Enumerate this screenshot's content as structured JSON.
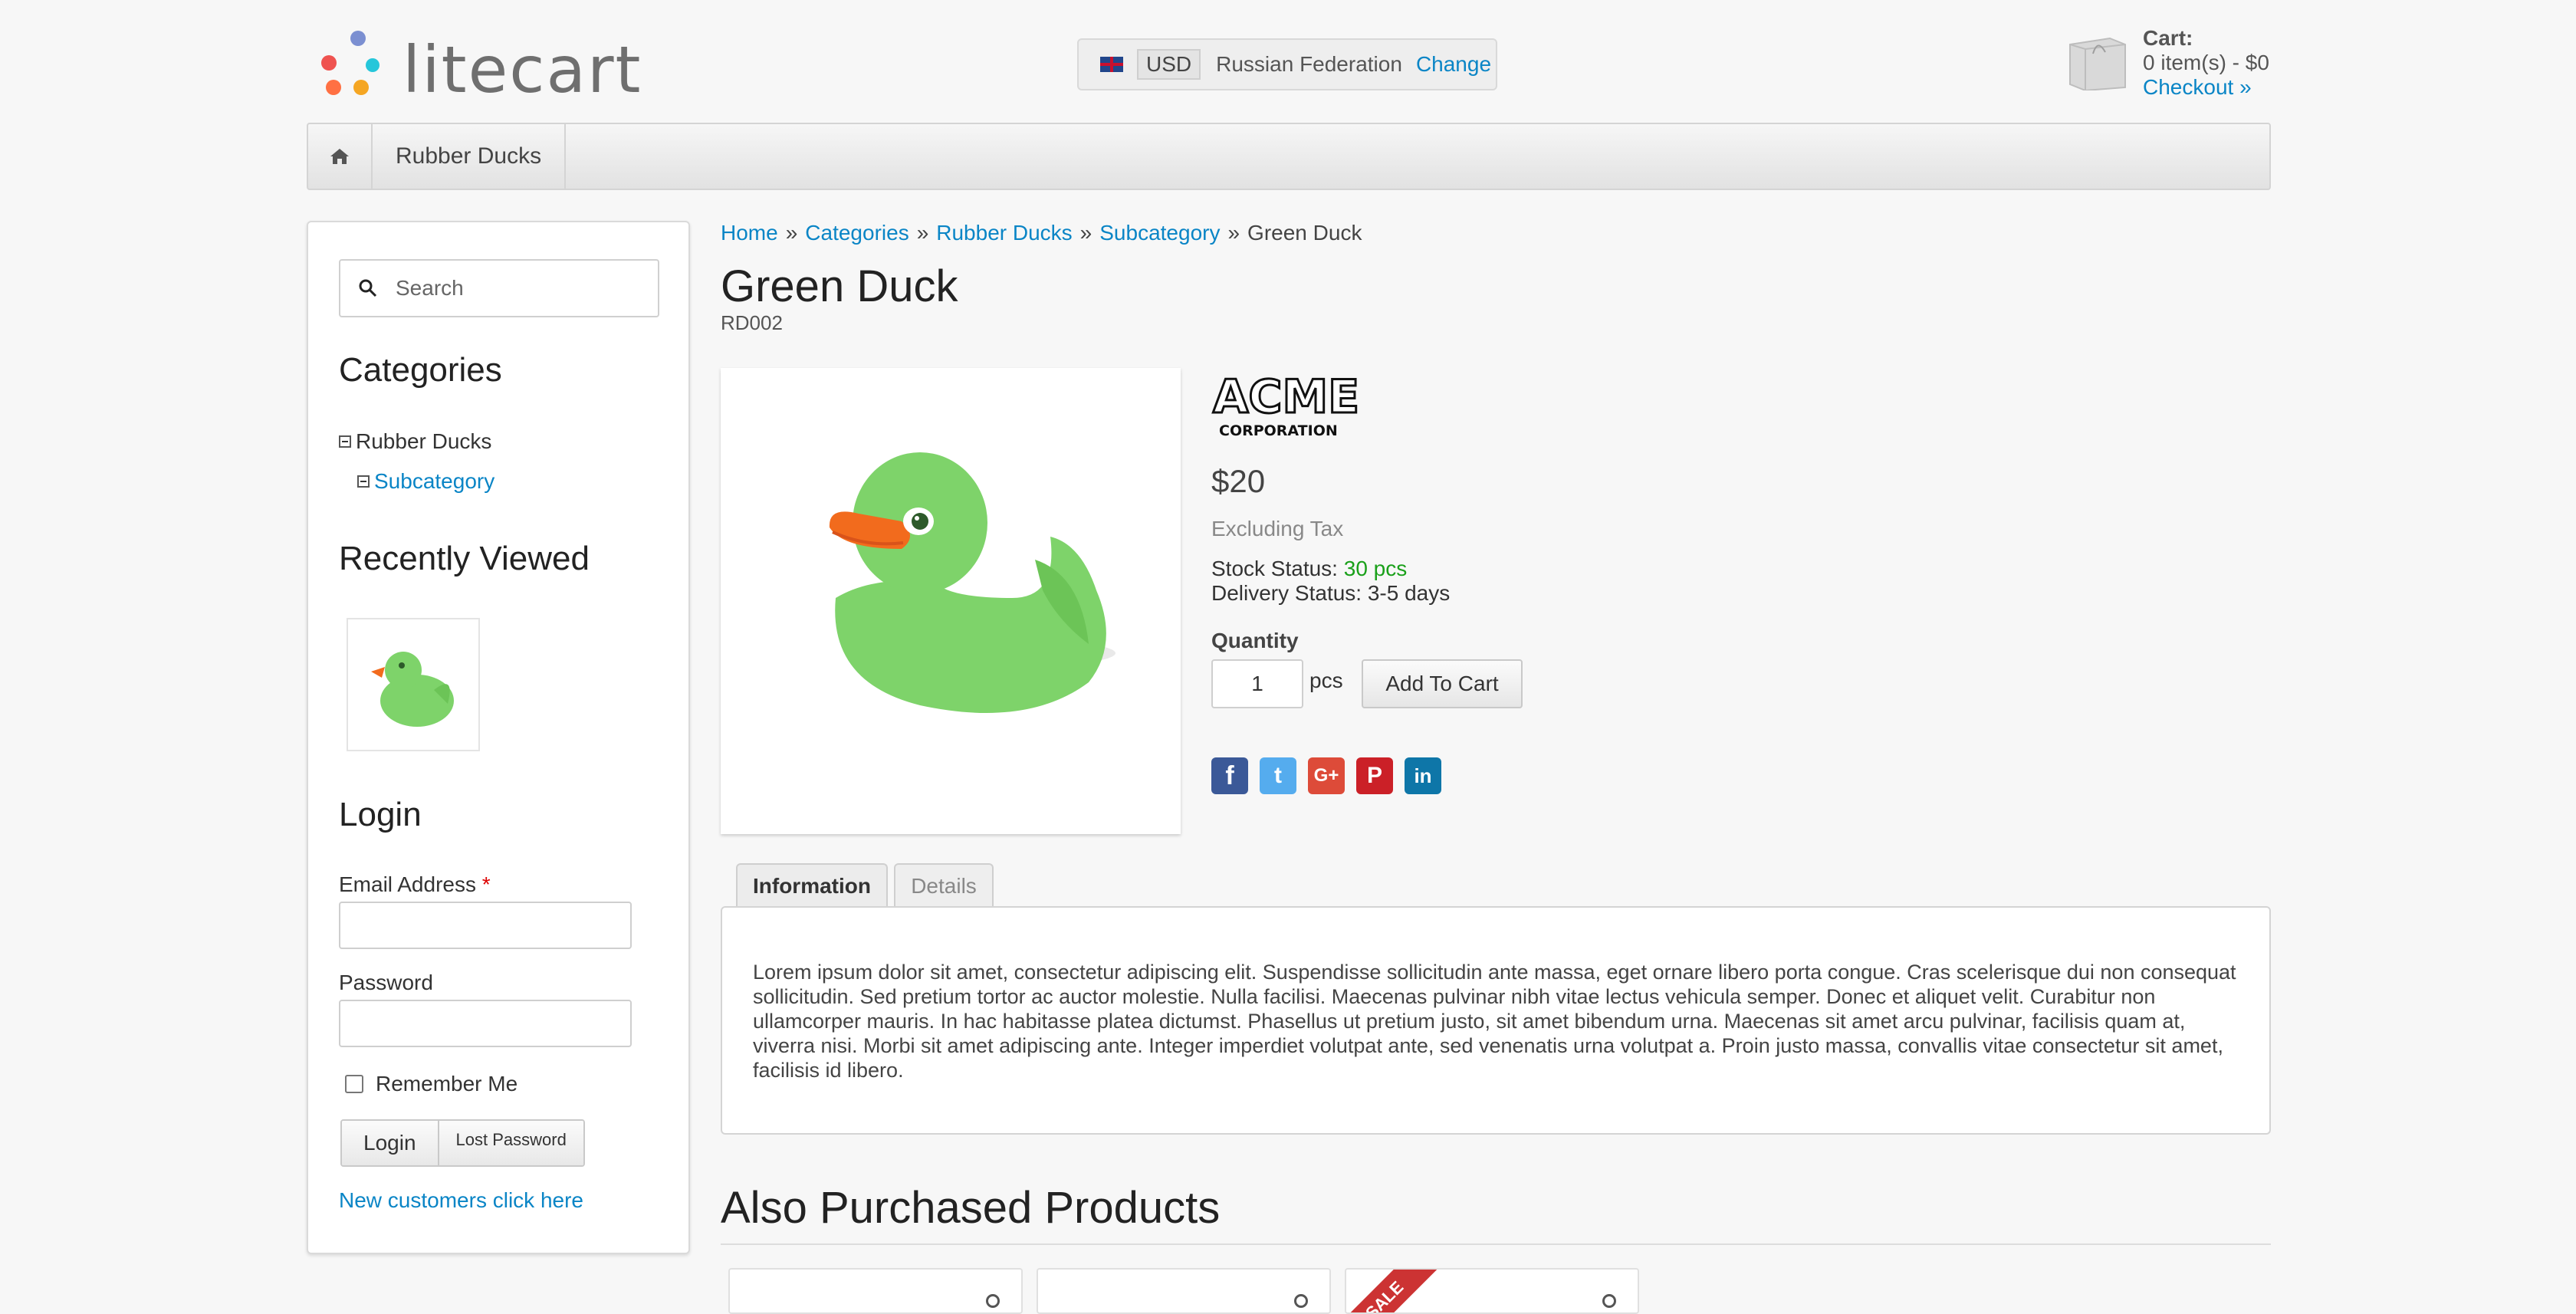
{
  "header": {
    "logo_text": "litecart",
    "region": {
      "currency": "USD",
      "country": "Russian Federation",
      "change_label": "Change"
    },
    "cart": {
      "title": "Cart:",
      "summary": "0 item(s) - $0",
      "checkout_label": "Checkout »"
    }
  },
  "nav": {
    "items": [
      {
        "label": "Rubber Ducks"
      }
    ]
  },
  "sidebar": {
    "search_placeholder": "Search",
    "categories_heading": "Categories",
    "categories": [
      {
        "label": "Rubber Ducks"
      },
      {
        "label": "Subcategory"
      }
    ],
    "recently_viewed_heading": "Recently Viewed",
    "login": {
      "heading": "Login",
      "email_label": "Email Address",
      "required_mark": "*",
      "password_label": "Password",
      "remember_label": "Remember Me",
      "login_button": "Login",
      "lost_password_button": "Lost Password",
      "new_customers_link": "New customers click here"
    }
  },
  "breadcrumb": {
    "items": [
      "Home",
      "Categories",
      "Rubber Ducks",
      "Subcategory"
    ],
    "current": "Green Duck",
    "separator": "»"
  },
  "product": {
    "title": "Green Duck",
    "sku": "RD002",
    "brand_line1": "ACME",
    "brand_line2": "CORPORATION",
    "price": "$20",
    "tax_note": "Excluding Tax",
    "stock_label": "Stock Status:",
    "stock_value": "30 pcs",
    "delivery": "Delivery Status: 3-5 days",
    "quantity_label": "Quantity",
    "quantity_value": "1",
    "unit": "pcs",
    "add_to_cart": "Add To Cart",
    "social": [
      {
        "name": "facebook",
        "glyph": "f",
        "color": "#3b5998"
      },
      {
        "name": "twitter",
        "glyph": "t",
        "color": "#55acee"
      },
      {
        "name": "google-plus",
        "glyph": "G+",
        "color": "#dd4b39"
      },
      {
        "name": "pinterest",
        "glyph": "P",
        "color": "#cb2027"
      },
      {
        "name": "linkedin",
        "glyph": "in",
        "color": "#0e76a8"
      }
    ],
    "tabs": [
      {
        "label": "Information"
      },
      {
        "label": "Details"
      }
    ],
    "description": "Lorem ipsum dolor sit amet, consectetur adipiscing elit. Suspendisse sollicitudin ante massa, eget ornare libero porta congue. Cras scelerisque dui non consequat sollicitudin. Sed pretium tortor ac auctor molestie. Nulla facilisi. Maecenas pulvinar nibh vitae lectus vehicula semper. Donec et aliquet velit. Curabitur non ullamcorper mauris. In hac habitasse platea dictumst. Phasellus ut pretium justo, sit amet bibendum urna. Maecenas sit amet arcu pulvinar, facilisis quam at, viverra nisi. Morbi sit amet adipiscing ante. Integer imperdiet volutpat ante, sed venenatis urna volutpat a. Proin justo massa, convallis vitae consectetur sit amet, facilisis id libero."
  },
  "also_purchased": {
    "heading": "Also Purchased Products",
    "sale_badge": "SALE"
  },
  "colors": {
    "link": "#0a85c6",
    "stock_ok": "#1aa01a",
    "duck_green": "#7ed36a",
    "beak": "#f26b1d"
  }
}
